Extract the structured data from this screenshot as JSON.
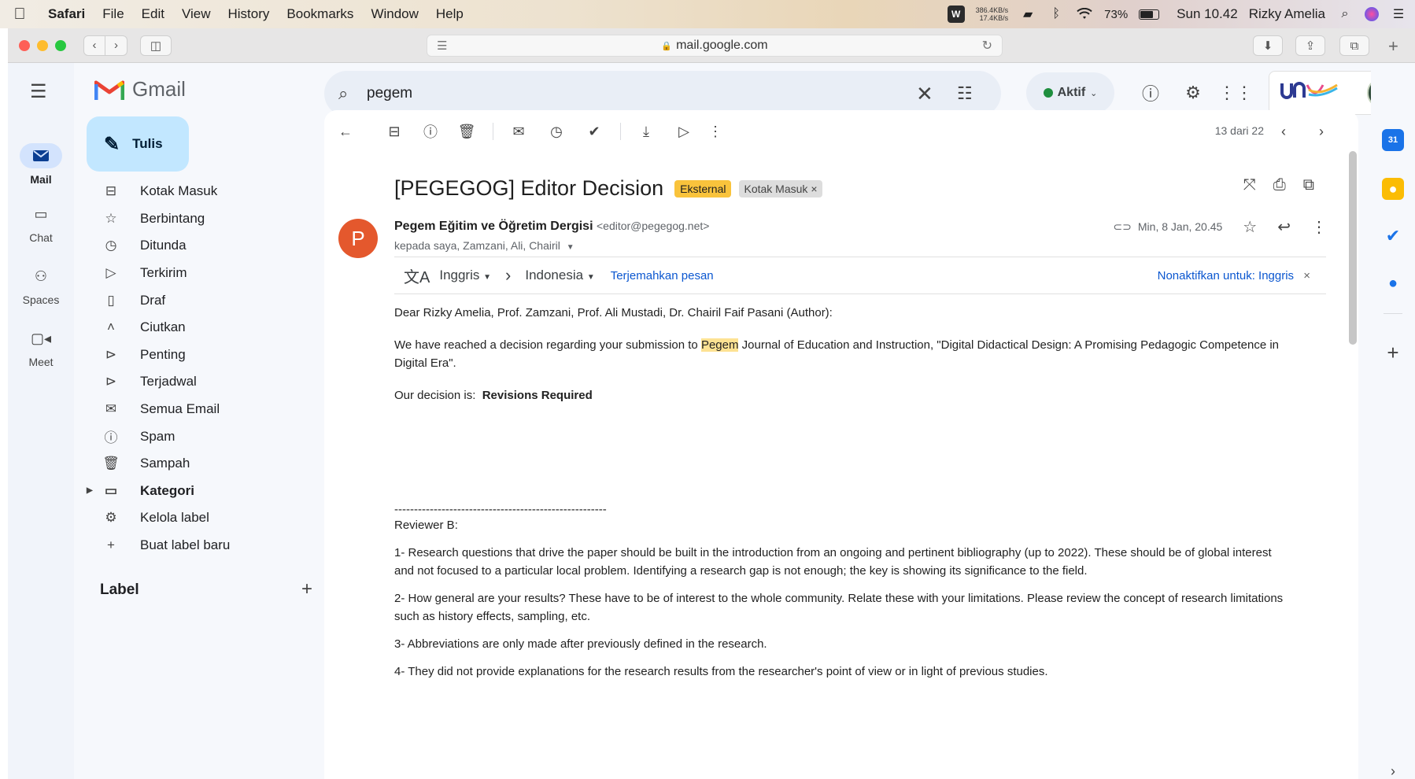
{
  "menubar": {
    "app": "Safari",
    "items": [
      "File",
      "Edit",
      "View",
      "History",
      "Bookmarks",
      "Window",
      "Help"
    ],
    "net_up": "386.4KB/s",
    "net_down": "17.4KB/s",
    "battery": "73%",
    "battery_level": 0.73,
    "clock": "Sun 10.42",
    "user": "Rizky Amelia"
  },
  "browser": {
    "url": "mail.google.com"
  },
  "gmail": {
    "product": "Gmail",
    "search_value": "pegem",
    "status": "Aktif",
    "rail": [
      "Mail",
      "Chat",
      "Spaces",
      "Meet"
    ],
    "compose": "Tulis",
    "nav": [
      {
        "label": "Kotak Masuk",
        "icon": "inbox-icon",
        "glyph": "⊟"
      },
      {
        "label": "Berbintang",
        "icon": "star-icon",
        "glyph": "☆"
      },
      {
        "label": "Ditunda",
        "icon": "snooze-icon",
        "glyph": "◷"
      },
      {
        "label": "Terkirim",
        "icon": "send-icon",
        "glyph": "▷"
      },
      {
        "label": "Draf",
        "icon": "draft-icon",
        "glyph": "▯"
      },
      {
        "label": "Ciutkan",
        "icon": "collapse-icon",
        "glyph": "˄"
      },
      {
        "label": "Penting",
        "icon": "important-icon",
        "glyph": "⊳"
      },
      {
        "label": "Terjadwal",
        "icon": "scheduled-icon",
        "glyph": "⊳"
      },
      {
        "label": "Semua Email",
        "icon": "all-mail-icon",
        "glyph": "✉"
      },
      {
        "label": "Spam",
        "icon": "spam-icon",
        "glyph": "ⓘ"
      },
      {
        "label": "Sampah",
        "icon": "trash-icon",
        "glyph": "🗑"
      },
      {
        "label": "Kategori",
        "icon": "label-icon",
        "glyph": "▭"
      },
      {
        "label": "Kelola label",
        "icon": "manage-labels-icon",
        "glyph": "⚙"
      },
      {
        "label": "Buat label baru",
        "icon": "plus-icon",
        "glyph": "+"
      }
    ],
    "labels_header": "Label",
    "pager": "13 dari 22"
  },
  "email": {
    "subject": "[PEGEGOG] Editor Decision",
    "badge_external": "Eksternal",
    "badge_inbox": "Kotak Masuk",
    "avatar_letter": "P",
    "sender_name": "Pegem Eğitim ve Öğretim Dergisi",
    "sender_email": "<editor@pegegog.net>",
    "recipients": "kepada saya, Zamzani, Ali, Chairil",
    "date": "Min, 8 Jan, 20.45",
    "translate": {
      "from": "Inggris",
      "to": "Indonesia",
      "action": "Terjemahkan pesan",
      "disable": "Nonaktifkan untuk: Inggris"
    },
    "greeting": "Dear Rizky Amelia, Prof. Zamzani, Prof. Ali Mustadi, Dr. Chairil Faif Pasani (Author):",
    "p1_before": "We have reached a decision regarding your submission to ",
    "p1_highlight": "Pegem",
    "p1_after": " Journal of Education and Instruction, \"Digital Didactical Design: A Promising Pedagogic Competence in Digital Era\".",
    "decision_prefix": "Our decision is:",
    "decision": "Revisions Required",
    "separator": "------------------------------------------------------",
    "reviewer": "Reviewer B:",
    "points": [
      "1- Research questions that drive the paper should be built in the introduction from an ongoing and pertinent bibliography (up to 2022). These should be of global interest and not focused to a particular local problem. Identifying a research gap is not enough; the key is showing its significance to the field.",
      "2- How general are your results? These have to be of interest to the whole community. Relate these with your limitations. Please review the concept of research limitations such as history effects, sampling, etc.",
      "3- Abbreviations are only made after previously defined in the research.",
      "4- They did not provide explanations for the research results from the researcher's point of view or in light of previous studies."
    ]
  }
}
